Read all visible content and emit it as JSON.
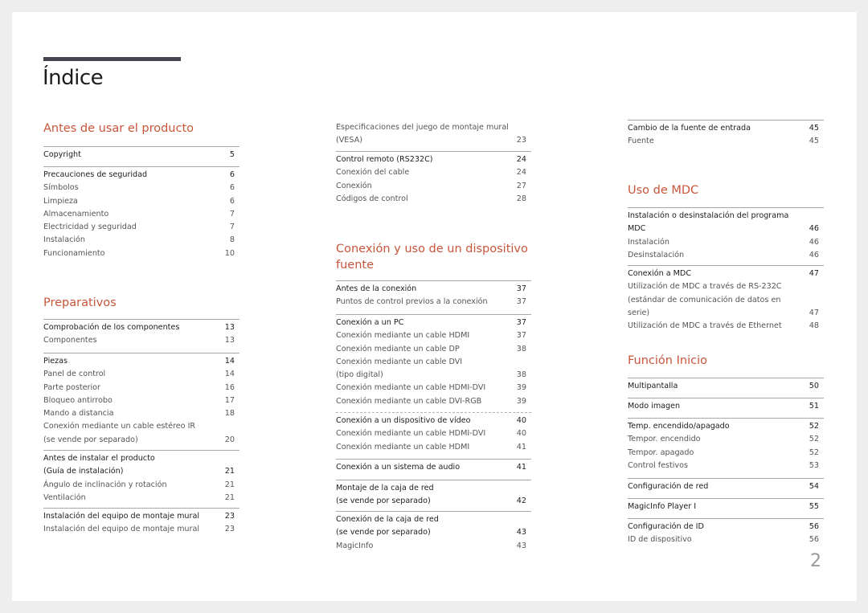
{
  "page_title": "Índice",
  "page_number": "2",
  "colors": {
    "accent": "#c8553a",
    "title_bar": "#454552",
    "background": "#eeeeee",
    "page": "#ffffff"
  },
  "left": {
    "sections": [
      {
        "title": "Antes de usar el producto",
        "groups": [
          {
            "items": [
              {
                "label": "Copyright",
                "page": "5",
                "level": "head"
              }
            ]
          },
          {
            "items": [
              {
                "label": "Precauciones de seguridad",
                "page": "6",
                "level": "head"
              },
              {
                "label": "Símbolos",
                "page": "6",
                "level": "sub"
              },
              {
                "label": "Limpieza",
                "page": "6",
                "level": "sub"
              },
              {
                "label": "Almacenamiento",
                "page": "7",
                "level": "sub"
              },
              {
                "label": "Electricidad y seguridad",
                "page": "7",
                "level": "sub"
              },
              {
                "label": "Instalación",
                "page": "8",
                "level": "sub"
              },
              {
                "label": "Funcionamiento",
                "page": "10",
                "level": "sub"
              }
            ]
          }
        ]
      },
      {
        "title": "Preparativos",
        "groups": [
          {
            "items": [
              {
                "label": "Comprobación de los componentes",
                "page": "13",
                "level": "head"
              },
              {
                "label": "Componentes",
                "page": "13",
                "level": "sub"
              }
            ]
          },
          {
            "items": [
              {
                "label": "Piezas",
                "page": "14",
                "level": "head"
              },
              {
                "label": "Panel de control",
                "page": "14",
                "level": "sub"
              },
              {
                "label": "Parte posterior",
                "page": "16",
                "level": "sub"
              },
              {
                "label": "Bloqueo antirrobo",
                "page": "17",
                "level": "sub"
              },
              {
                "label": "Mando a distancia",
                "page": "18",
                "level": "sub"
              },
              {
                "label": "Conexión mediante un cable estéreo IR\n(se vende por separado)",
                "page": "20",
                "level": "sub"
              }
            ]
          },
          {
            "items": [
              {
                "label": "Antes de instalar el producto\n(Guía de instalación)",
                "page": "21",
                "level": "head"
              },
              {
                "label": "Ángulo de inclinación y rotación",
                "page": "21",
                "level": "sub"
              },
              {
                "label": "Ventilación",
                "page": "21",
                "level": "sub"
              }
            ]
          },
          {
            "items": [
              {
                "label": "Instalación del equipo de montaje mural",
                "page": "23",
                "level": "head"
              },
              {
                "label": "Instalación del equipo de montaje mural",
                "page": "23",
                "level": "sub"
              }
            ]
          }
        ]
      }
    ]
  },
  "middle": {
    "continued_groups": [
      {
        "items": [
          {
            "label": "Especificaciones del juego de montaje mural\n(VESA)",
            "page": "23",
            "level": "sub"
          }
        ]
      },
      {
        "items": [
          {
            "label": "Control remoto (RS232C)",
            "page": "24",
            "level": "head"
          },
          {
            "label": "Conexión del cable",
            "page": "24",
            "level": "sub"
          },
          {
            "label": "Conexión",
            "page": "27",
            "level": "sub"
          },
          {
            "label": "Códigos de control",
            "page": "28",
            "level": "sub"
          }
        ]
      }
    ],
    "sections": [
      {
        "title": "Conexión y uso de un dispositivo fuente",
        "groups": [
          {
            "items": [
              {
                "label": "Antes de la conexión",
                "page": "37",
                "level": "head"
              },
              {
                "label": "Puntos de control previos a la conexión",
                "page": "37",
                "level": "sub"
              }
            ]
          },
          {
            "items": [
              {
                "label": "Conexión a un PC",
                "page": "37",
                "level": "head"
              },
              {
                "label": "Conexión mediante un cable HDMI",
                "page": "37",
                "level": "sub"
              },
              {
                "label": "Conexión mediante un cable DP",
                "page": "38",
                "level": "sub"
              },
              {
                "label": "Conexión mediante un cable DVI\n(tipo digital)",
                "page": "38",
                "level": "sub"
              },
              {
                "label": "Conexión mediante un cable HDMI-DVI",
                "page": "39",
                "level": "sub"
              },
              {
                "label": "Conexión mediante un cable DVI-RGB",
                "page": "39",
                "level": "sub"
              }
            ]
          },
          {
            "items": [
              {
                "label": "Conexión a un dispositivo de vídeo",
                "page": "40",
                "level": "head"
              },
              {
                "label": "Conexión mediante un cable HDMI-DVI",
                "page": "40",
                "level": "sub"
              },
              {
                "label": "Conexión mediante un cable HDMI",
                "page": "41",
                "level": "sub"
              }
            ]
          },
          {
            "items": [
              {
                "label": "Conexión a un sistema de audio",
                "page": "41",
                "level": "head"
              }
            ]
          },
          {
            "items": [
              {
                "label": "Montaje de la caja de red\n(se vende por separado)",
                "page": "42",
                "level": "head"
              }
            ]
          },
          {
            "items": [
              {
                "label": "Conexión de la caja de red\n(se vende por separado)",
                "page": "43",
                "level": "head"
              },
              {
                "label": "MagicInfo",
                "page": "43",
                "level": "sub"
              }
            ]
          }
        ]
      }
    ]
  },
  "right": {
    "continued_groups": [
      {
        "items": [
          {
            "label": "Cambio de la fuente de entrada",
            "page": "45",
            "level": "head"
          },
          {
            "label": "Fuente",
            "page": "45",
            "level": "sub"
          }
        ]
      }
    ],
    "sections": [
      {
        "title": "Uso de MDC",
        "groups": [
          {
            "items": [
              {
                "label": "Instalación o desinstalación del programa\nMDC",
                "page": "46",
                "level": "head"
              },
              {
                "label": "Instalación",
                "page": "46",
                "level": "sub"
              },
              {
                "label": "Desinstalación",
                "page": "46",
                "level": "sub"
              }
            ]
          },
          {
            "items": [
              {
                "label": "Conexión a MDC",
                "page": "47",
                "level": "head"
              },
              {
                "label": "Utilización de MDC a través de RS-232C\n(estándar de comunicación de datos en serie)",
                "page": "47",
                "level": "sub"
              },
              {
                "label": "Utilización de MDC a través de Ethernet",
                "page": "48",
                "level": "sub"
              }
            ]
          }
        ]
      },
      {
        "title": "Función Inicio",
        "groups": [
          {
            "items": [
              {
                "label": "Multipantalla",
                "page": "50",
                "level": "head"
              }
            ]
          },
          {
            "items": [
              {
                "label": "Modo imagen",
                "page": "51",
                "level": "head"
              }
            ]
          },
          {
            "items": [
              {
                "label": "Temp. encendido/apagado",
                "page": "52",
                "level": "head"
              },
              {
                "label": "Tempor. encendido",
                "page": "52",
                "level": "sub"
              },
              {
                "label": "Tempor. apagado",
                "page": "52",
                "level": "sub"
              },
              {
                "label": "Control festivos",
                "page": "53",
                "level": "sub"
              }
            ]
          },
          {
            "items": [
              {
                "label": "Configuración de red",
                "page": "54",
                "level": "head"
              }
            ]
          },
          {
            "items": [
              {
                "label": "MagicInfo Player I",
                "page": "55",
                "level": "head"
              }
            ]
          },
          {
            "items": [
              {
                "label": "Configuración de ID",
                "page": "56",
                "level": "head"
              },
              {
                "label": "ID de dispositivo",
                "page": "56",
                "level": "sub"
              }
            ]
          }
        ]
      }
    ]
  }
}
